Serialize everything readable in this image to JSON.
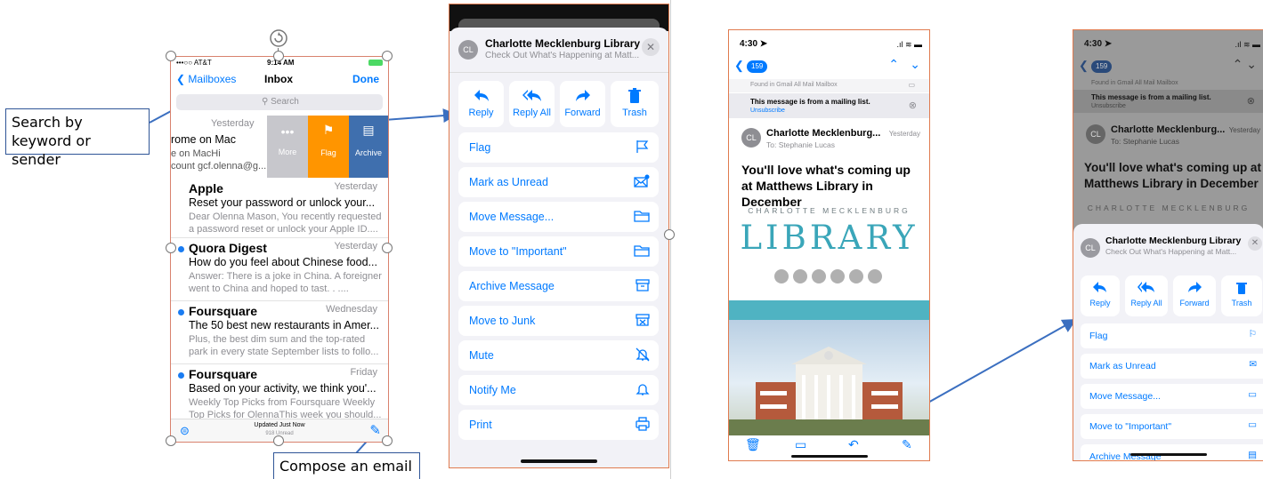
{
  "annotations": {
    "search_callout": "Search by keyword or sender",
    "compose_callout": "Compose an email"
  },
  "phone1": {
    "status": {
      "carrier": "•••○○ AT&T",
      "time": "9:14 AM"
    },
    "nav": {
      "back": "Mailboxes",
      "title": "Inbox",
      "done": "Done"
    },
    "search_placeholder": "Search",
    "swiped_row": {
      "time": "Yesterday",
      "line1": "rome on Mac",
      "line2": "e on MacHi",
      "line3": "count gcf.olenna@g..."
    },
    "swipe_actions": {
      "more": "More",
      "flag": "Flag",
      "archive": "Archive"
    },
    "emails": [
      {
        "sender": "Apple",
        "time": "Yesterday",
        "subject": "Reset your password or unlock your...",
        "preview1": "Dear Olenna Mason, You recently requested",
        "preview2": "a password reset or unlock your Apple ID....",
        "unread": false
      },
      {
        "sender": "Quora Digest",
        "time": "Yesterday",
        "subject": "How do you feel about Chinese food...",
        "preview1": "Answer: There is a joke in China. A foreigner",
        "preview2": "went to China and hoped to tast. . ....",
        "unread": true
      },
      {
        "sender": "Foursquare",
        "time": "Wednesday",
        "subject": "The 50 best new restaurants in Amer...",
        "preview1": "Plus, the best dim sum and the top-rated",
        "preview2": "park in every state September lists to follo...",
        "unread": true
      },
      {
        "sender": "Foursquare",
        "time": "Friday",
        "subject": "Based on your activity, we think you'...",
        "preview1": "Weekly Top Picks from Foursquare Weekly",
        "preview2": "Top Picks for OlennaThis week you should...",
        "unread": true
      }
    ],
    "footer": {
      "status": "Updated Just Now",
      "sub": "918 Unread"
    }
  },
  "sheet": {
    "avatar": "CL",
    "sender": "Charlotte Mecklenburg Library",
    "subject": "Check Out What's Happening at Matt...",
    "actions": [
      {
        "label": "Reply",
        "icon": "reply-icon"
      },
      {
        "label": "Reply All",
        "icon": "reply-all-icon"
      },
      {
        "label": "Forward",
        "icon": "forward-icon"
      },
      {
        "label": "Trash",
        "icon": "trash-icon"
      }
    ],
    "menu": [
      {
        "label": "Flag",
        "icon": "flag-icon"
      },
      {
        "label": "Mark as Unread",
        "icon": "envelope-icon"
      },
      {
        "label": "Move Message...",
        "icon": "folder-icon"
      },
      {
        "label": "Move to \"Important\"",
        "icon": "folder-icon"
      },
      {
        "label": "Archive Message",
        "icon": "archive-icon"
      },
      {
        "label": "Move to Junk",
        "icon": "junk-icon"
      },
      {
        "label": "Mute",
        "icon": "bell-slash-icon"
      },
      {
        "label": "Notify Me",
        "icon": "bell-icon"
      },
      {
        "label": "Print",
        "icon": "printer-icon"
      }
    ]
  },
  "phone3": {
    "time": "4:30",
    "badge": "159",
    "found_in": "Found in Gmail All Mail Mailbox",
    "mailing_list": "This message is from a mailing list.",
    "unsubscribe": "Unsubscribe",
    "avatar": "CL",
    "sender": "Charlotte Mecklenburg...",
    "date": "Yesterday",
    "to": "To: Stephanie Lucas",
    "headline": "You'll love what's coming up at Matthews Library in December",
    "brand_top": "CHARLOTTE MECKLENBURG",
    "brand_main": "LIBRARY",
    "brand_color": "#3aa6b9"
  },
  "phone4": {
    "time": "4:30",
    "badge": "159",
    "found_in": "Found in Gmail All Mail Mailbox",
    "mailing_list": "This message is from a mailing list.",
    "unsubscribe": "Unsubscribe",
    "avatar": "CL",
    "sender": "Charlotte Mecklenburg...",
    "date": "Yesterday",
    "to": "To: Stephanie Lucas",
    "headline": "You'll love what's coming up at Matthews Library in December",
    "brand_top": "CHARLOTTE MECKLENBURG",
    "sheet_sender": "Charlotte Mecklenburg Library",
    "sheet_subject": "Check Out What's Happening at Matt...",
    "actions": [
      "Reply",
      "Reply All",
      "Forward",
      "Trash"
    ],
    "menu": [
      "Flag",
      "Mark as Unread",
      "Move Message...",
      "Move to \"Important\"",
      "Archive Message"
    ]
  },
  "colors": {
    "ios_blue": "#007aff",
    "annotation_blue": "#2f5597",
    "frame_orange": "#e07b4f",
    "swipe_more": "#c7c7cc",
    "swipe_flag": "#ff9500",
    "swipe_archive": "#3f6fae"
  }
}
